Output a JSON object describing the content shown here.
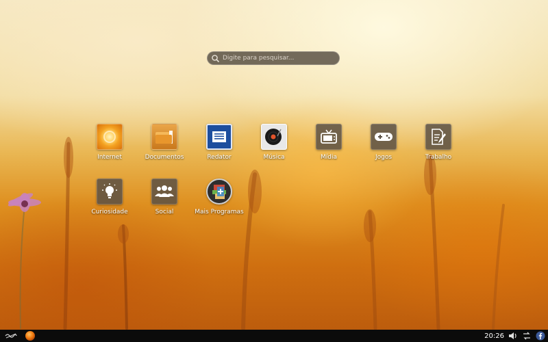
{
  "search": {
    "placeholder": "Digite para pesquisar..."
  },
  "apps": [
    {
      "label": "Internet",
      "icon": "internet-icon"
    },
    {
      "label": "Documentos",
      "icon": "folder-icon"
    },
    {
      "label": "Redator",
      "icon": "writer-icon"
    },
    {
      "label": "Música",
      "icon": "music-icon"
    },
    {
      "label": "Mídia",
      "icon": "tv-icon"
    },
    {
      "label": "Jogos",
      "icon": "gamepad-icon"
    },
    {
      "label": "Trabalho",
      "icon": "document-edit-icon"
    },
    {
      "label": "Curiosidade",
      "icon": "lightbulb-icon"
    },
    {
      "label": "Social",
      "icon": "people-icon"
    },
    {
      "label": "Mais Programas",
      "icon": "software-center-icon"
    }
  ],
  "taskbar": {
    "clock": "20:26",
    "icons": [
      "link-icon",
      "launcher-orb-icon",
      "volume-icon",
      "network-icon",
      "facebook-icon"
    ]
  },
  "colors": {
    "taskbar": "#0b0b0b",
    "tile_gray": "#5a5044",
    "writer_blue": "#1d4e9e",
    "orb_orange": "#f07a10"
  }
}
